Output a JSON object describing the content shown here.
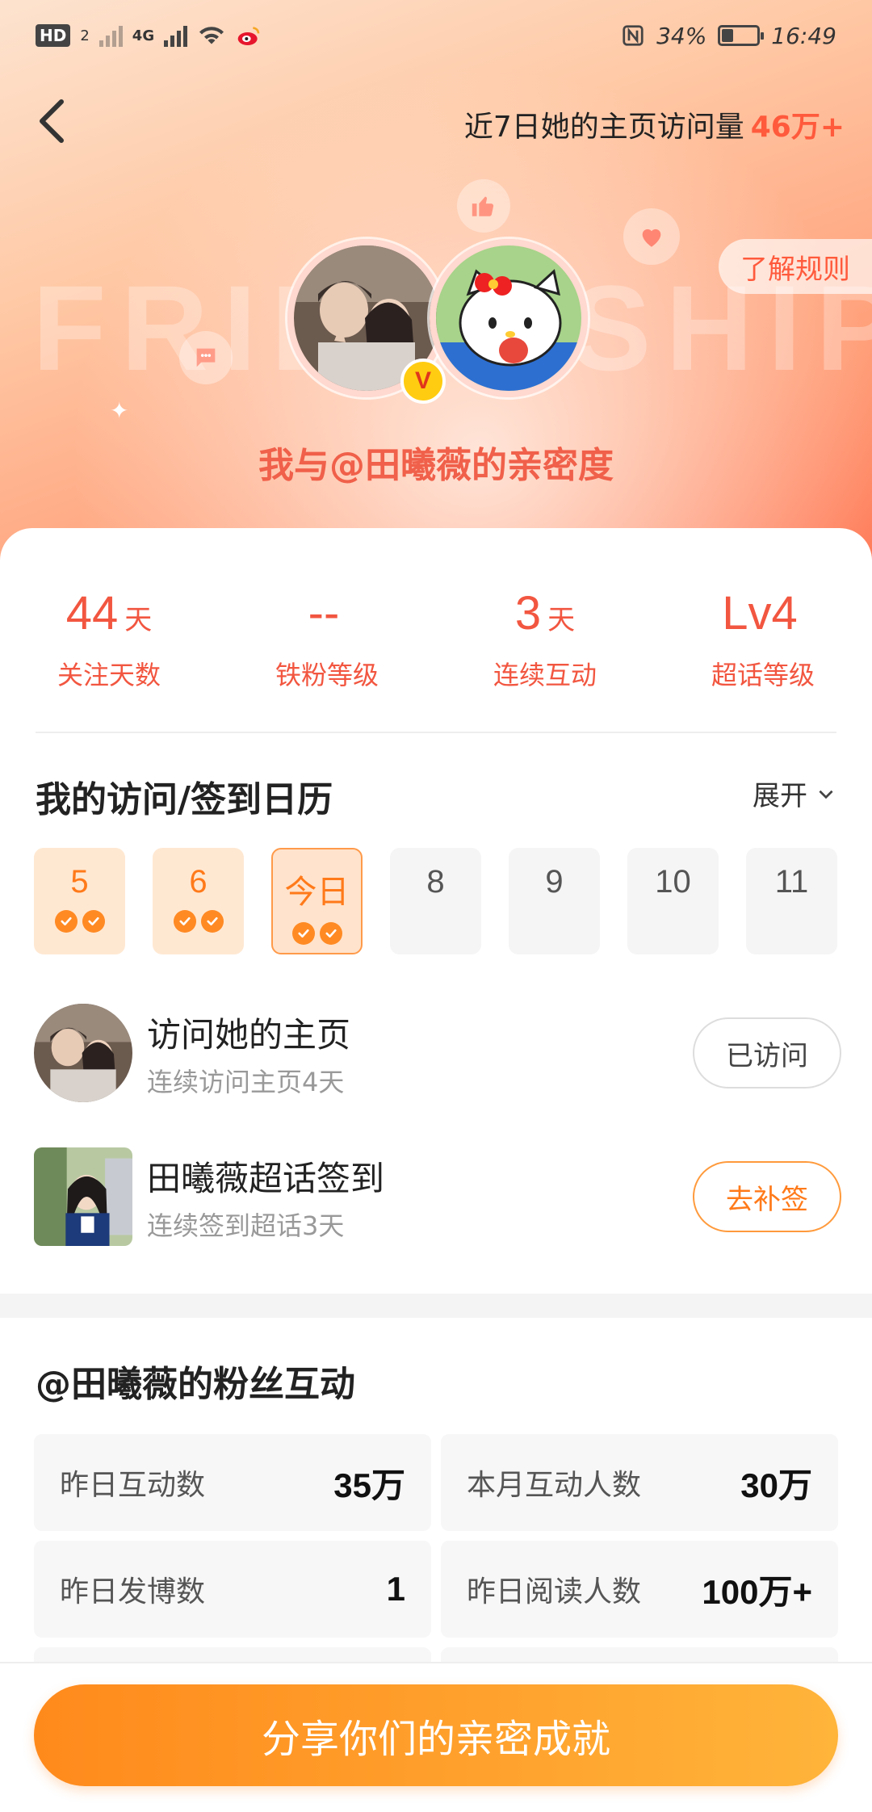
{
  "status_bar": {
    "hd": "HD",
    "hd_sub": "2",
    "network": "4G",
    "battery_text": "34%",
    "battery_level": 0.34,
    "time": "16:49"
  },
  "header": {
    "visit_prefix": "近7日她的主页访问量",
    "visit_value": "46万+",
    "rules_button": "了解规则",
    "watermark": "FRIENDSHIP",
    "intimacy_title": "我与@田曦薇的亲密度",
    "verify_badge": "V"
  },
  "stats": [
    {
      "value": "44",
      "unit": "天",
      "label": "关注天数"
    },
    {
      "value": "--",
      "unit": "",
      "label": "铁粉等级"
    },
    {
      "value": "3",
      "unit": "天",
      "label": "连续互动"
    },
    {
      "value": "Lv4",
      "unit": "",
      "label": "超话等级"
    }
  ],
  "calendar": {
    "title": "我的访问/签到日历",
    "expand_label": "展开",
    "days": [
      {
        "label": "5",
        "checks": 2
      },
      {
        "label": "6",
        "checks": 2
      },
      {
        "label": "今日",
        "checks": 2
      },
      {
        "label": "8",
        "checks": 0
      },
      {
        "label": "9",
        "checks": 0
      },
      {
        "label": "10",
        "checks": 0
      },
      {
        "label": "11",
        "checks": 0
      }
    ]
  },
  "tasks": [
    {
      "title": "访问她的主页",
      "subtitle": "连续访问主页4天",
      "button": "已访问"
    },
    {
      "title": "田曦薇超话签到",
      "subtitle": "连续签到超话3天",
      "button": "去补签"
    }
  ],
  "fans": {
    "title": "@田曦薇的粉丝互动",
    "cells": [
      {
        "label": "昨日互动数",
        "value": "35万"
      },
      {
        "label": "本月互动人数",
        "value": "30万"
      },
      {
        "label": "昨日发博数",
        "value": "1"
      },
      {
        "label": "昨日阅读人数",
        "value": "100万+"
      }
    ]
  },
  "share_button": "分享你们的亲密成就",
  "colors": {
    "accent": "#f25640",
    "orange": "#ff8a1c",
    "highlight": "#ff5a3c"
  }
}
